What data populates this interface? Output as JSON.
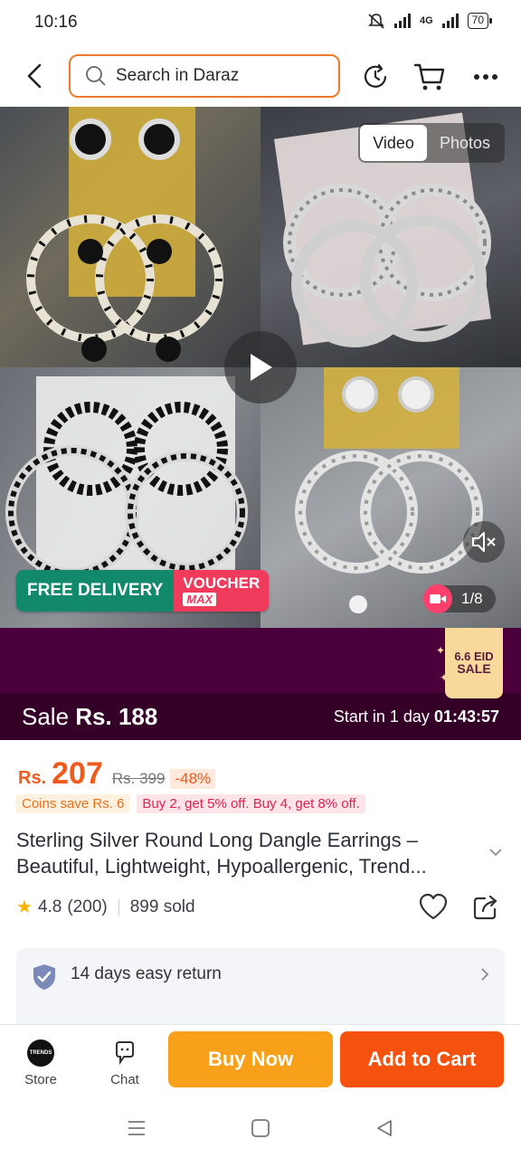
{
  "status_bar": {
    "time": "10:16",
    "network": "4G",
    "battery": "70"
  },
  "header": {
    "search_placeholder": "Search in Daraz"
  },
  "media": {
    "tabs": [
      {
        "label": "Video",
        "active": true
      },
      {
        "label": "Photos",
        "active": false
      }
    ],
    "free_delivery": "FREE DELIVERY",
    "voucher": "VOUCHER",
    "voucher_sub": "MAX",
    "counter": "1/8"
  },
  "campaign": {
    "badge_line1": "6.6 EID",
    "badge_line2": "SALE",
    "sale_label": "Sale",
    "sale_price": "Rs. 188",
    "start_text": "Start in 1 day",
    "countdown": "01:43:57",
    "background_color": "#4a003a"
  },
  "price": {
    "currency": "Rs.",
    "amount": "207",
    "original": "Rs. 399",
    "discount": "-48%",
    "accent_color": "#f05a1a"
  },
  "promos": {
    "coins": "Coins save Rs. 6",
    "bundle": "Buy 2, get 5% off. Buy 4, get 8% off."
  },
  "product": {
    "title_line1": "Sterling Silver Round Long Dangle Earrings –",
    "title_line2": "Beautiful, Lightweight, Hypoallergenic, Trend...",
    "rating": "4.8",
    "reviews": "(200)",
    "sold": "899 sold"
  },
  "service": {
    "return_text": "14 days easy return"
  },
  "bottom_bar": {
    "store_label": "Store",
    "store_logo": "TRENDS",
    "chat_label": "Chat",
    "buy_now": "Buy Now",
    "add_to_cart": "Add to Cart",
    "buy_now_color": "#f9a01b",
    "add_to_cart_color": "#f5520f"
  },
  "icons": [
    "back-arrow-icon",
    "search-icon",
    "history-icon",
    "cart-icon",
    "more-icon",
    "play-icon",
    "mute-icon",
    "video-icon",
    "chevron-down-icon",
    "star-icon",
    "heart-icon",
    "share-icon",
    "shield-check-icon",
    "chevron-right-icon",
    "chat-icon",
    "menu-nav-icon",
    "home-nav-icon",
    "back-nav-icon"
  ]
}
